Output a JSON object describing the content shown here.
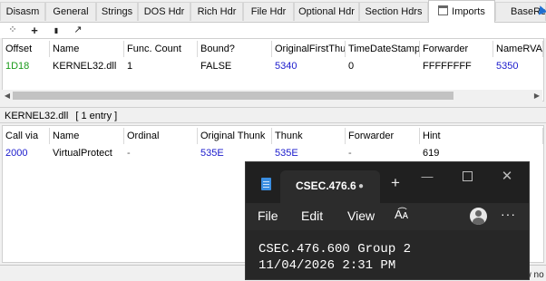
{
  "tabs": [
    {
      "label": "Disasm"
    },
    {
      "label": "General"
    },
    {
      "label": "Strings"
    },
    {
      "label": "DOS Hdr"
    },
    {
      "label": "Rich Hdr"
    },
    {
      "label": "File Hdr"
    },
    {
      "label": "Optional Hdr"
    },
    {
      "label": "Section Hdrs"
    },
    {
      "label": "Imports",
      "active": true
    },
    {
      "label": "BaseReloc"
    }
  ],
  "toolbar": {
    "buttons": [
      {
        "icon": "move-icon",
        "glyph": "⁘"
      },
      {
        "icon": "add-icon",
        "glyph": "+"
      },
      {
        "icon": "save-icon",
        "glyph": "▮"
      },
      {
        "icon": "edit-icon",
        "glyph": "↗"
      }
    ]
  },
  "imports_table": {
    "columns": [
      "Offset",
      "Name",
      "Func. Count",
      "Bound?",
      "OriginalFirstThunk",
      "TimeDateStamp",
      "Forwarder",
      "NameRVA"
    ],
    "rows": [
      [
        "1D18",
        "KERNEL32.dll",
        "1",
        "FALSE",
        "5340",
        "0",
        "FFFFFFFF",
        "5350"
      ]
    ]
  },
  "section_bar": {
    "dll": "KERNEL32.dll",
    "count": "[ 1 entry ]"
  },
  "functions_table": {
    "columns": [
      "Call via",
      "Name",
      "Ordinal",
      "Original Thunk",
      "Thunk",
      "Forwarder",
      "Hint"
    ],
    "rows": [
      [
        "2000",
        "VirtualProtect",
        "-",
        "535E",
        "535E",
        "-",
        "619"
      ]
    ]
  },
  "status_fragment": "ow no",
  "notepad": {
    "tab_title": "CSEC.476.6",
    "tab_dot": "●",
    "new_tab": "+",
    "minimize": "—",
    "close": "✕",
    "menu": {
      "file": "File",
      "edit": "Edit",
      "view": "View",
      "format": "A͡ᴀ"
    },
    "more": "···",
    "lines": [
      "CSEC.476.600 Group 2",
      "11/04/2026 2:31 PM"
    ]
  },
  "colors": {
    "offset_green": "#1a9a1a",
    "value_blue": "#1a1acc",
    "notepad_bg": "#202020"
  }
}
